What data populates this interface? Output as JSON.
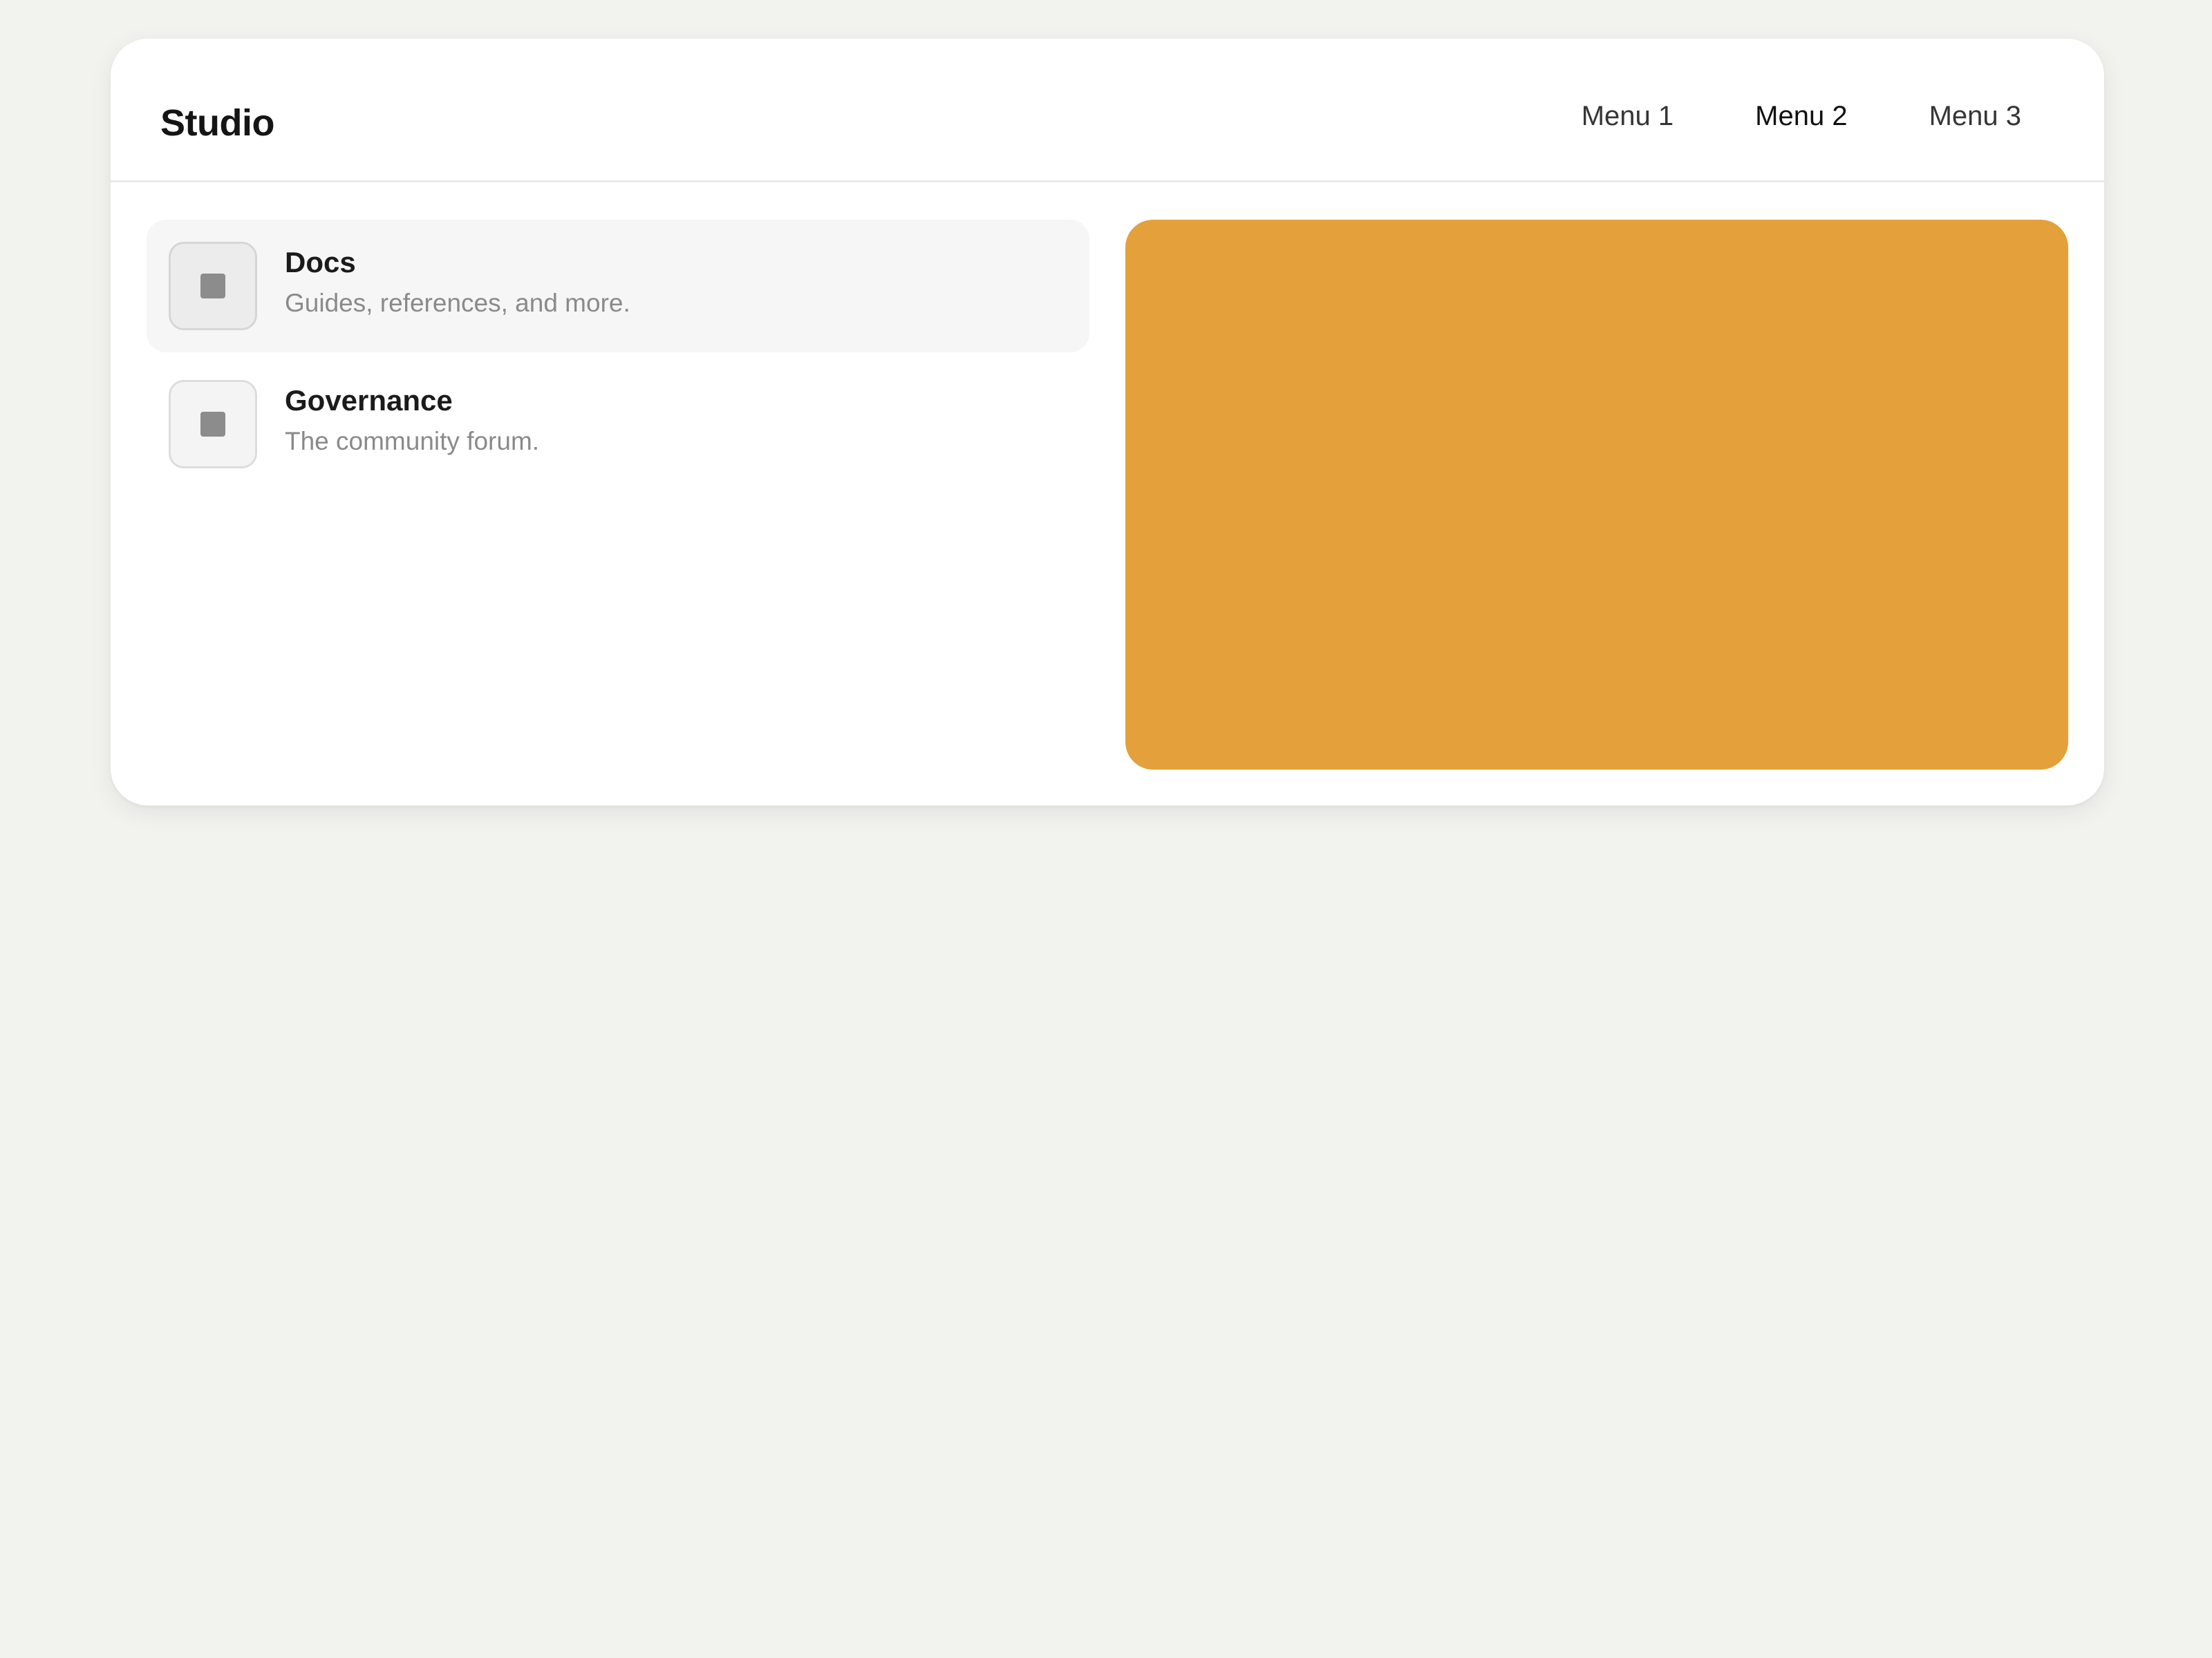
{
  "header": {
    "brand": "Studio",
    "nav": [
      {
        "label": "Menu 1",
        "active": false
      },
      {
        "label": "Menu 2",
        "active": true
      },
      {
        "label": "Menu 3",
        "active": false
      }
    ]
  },
  "list": {
    "items": [
      {
        "title": "Docs",
        "description": "Guides, references, and more.",
        "icon": "square-icon",
        "highlighted": true
      },
      {
        "title": "Governance",
        "description": "The community forum.",
        "icon": "square-icon",
        "highlighted": false
      }
    ]
  },
  "feature": {
    "color": "#e4a03a"
  },
  "colors": {
    "page_background": "#f2f2ef",
    "card_background": "#ffffff",
    "accent": "#e4a03a"
  }
}
